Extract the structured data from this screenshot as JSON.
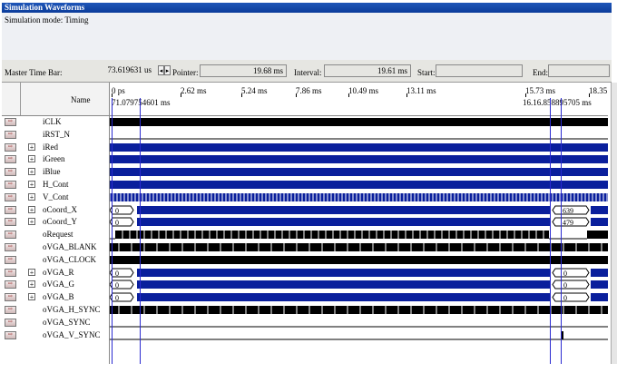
{
  "window": {
    "title": "Simulation Waveforms",
    "mode": "Simulation mode: Timing"
  },
  "toolbar": {
    "master_label": "Master Time Bar:",
    "master_value": "73.619631 us",
    "nav_left": "◂",
    "nav_right": "▸",
    "pointer_label": "Pointer:",
    "pointer_value": "19.68 ms",
    "interval_label": "Interval:",
    "interval_value": "19.61 ms",
    "start_label": "Start:",
    "start_value": "",
    "end_label": "End:",
    "end_value": ""
  },
  "names_header": "Name",
  "ruler": {
    "ticks": [
      "0 ps",
      "2.62 ms",
      "5.24 ms",
      "7.86 ms",
      "10.49 ms",
      "13.11 ms",
      "15.73 ms",
      "18.35"
    ],
    "cursor_left": "71.079754601 ms",
    "cursor_right": "16.16.858895705 ms"
  },
  "signals": [
    {
      "name": "iCLK",
      "group": false,
      "wave": "solid"
    },
    {
      "name": "iRST_N",
      "group": false,
      "wave": "low"
    },
    {
      "name": "iRed",
      "group": true,
      "wave": "bus"
    },
    {
      "name": "iGreen",
      "group": true,
      "wave": "bus"
    },
    {
      "name": "iBlue",
      "group": true,
      "wave": "bus"
    },
    {
      "name": "H_Cont",
      "group": true,
      "wave": "bus"
    },
    {
      "name": "V_Cont",
      "group": true,
      "wave": "dense"
    },
    {
      "name": "oCoord_X",
      "group": true,
      "wave": "val",
      "v0": "0",
      "v1": "639"
    },
    {
      "name": "oCoord_Y",
      "group": true,
      "wave": "val",
      "v0": "0",
      "v1": "479"
    },
    {
      "name": "oRequest",
      "group": false,
      "wave": "req"
    },
    {
      "name": "oVGA_BLANK",
      "group": false,
      "wave": "pulses"
    },
    {
      "name": "oVGA_CLOCK",
      "group": false,
      "wave": "solid"
    },
    {
      "name": "oVGA_R",
      "group": true,
      "wave": "val",
      "v0": "0",
      "v1": "0"
    },
    {
      "name": "oVGA_G",
      "group": true,
      "wave": "val",
      "v0": "0",
      "v1": "0"
    },
    {
      "name": "oVGA_B",
      "group": true,
      "wave": "val",
      "v0": "0",
      "v1": "0"
    },
    {
      "name": "oVGA_H_SYNC",
      "group": false,
      "wave": "pulses"
    },
    {
      "name": "oVGA_SYNC",
      "group": false,
      "wave": "low"
    },
    {
      "name": "oVGA_V_SYNC",
      "group": false,
      "wave": "vsync"
    }
  ],
  "colors": {
    "bus": "#0a1f9c",
    "solid": "#000000",
    "cursor": "#2a2ad0",
    "title": "#0b3c9a"
  }
}
